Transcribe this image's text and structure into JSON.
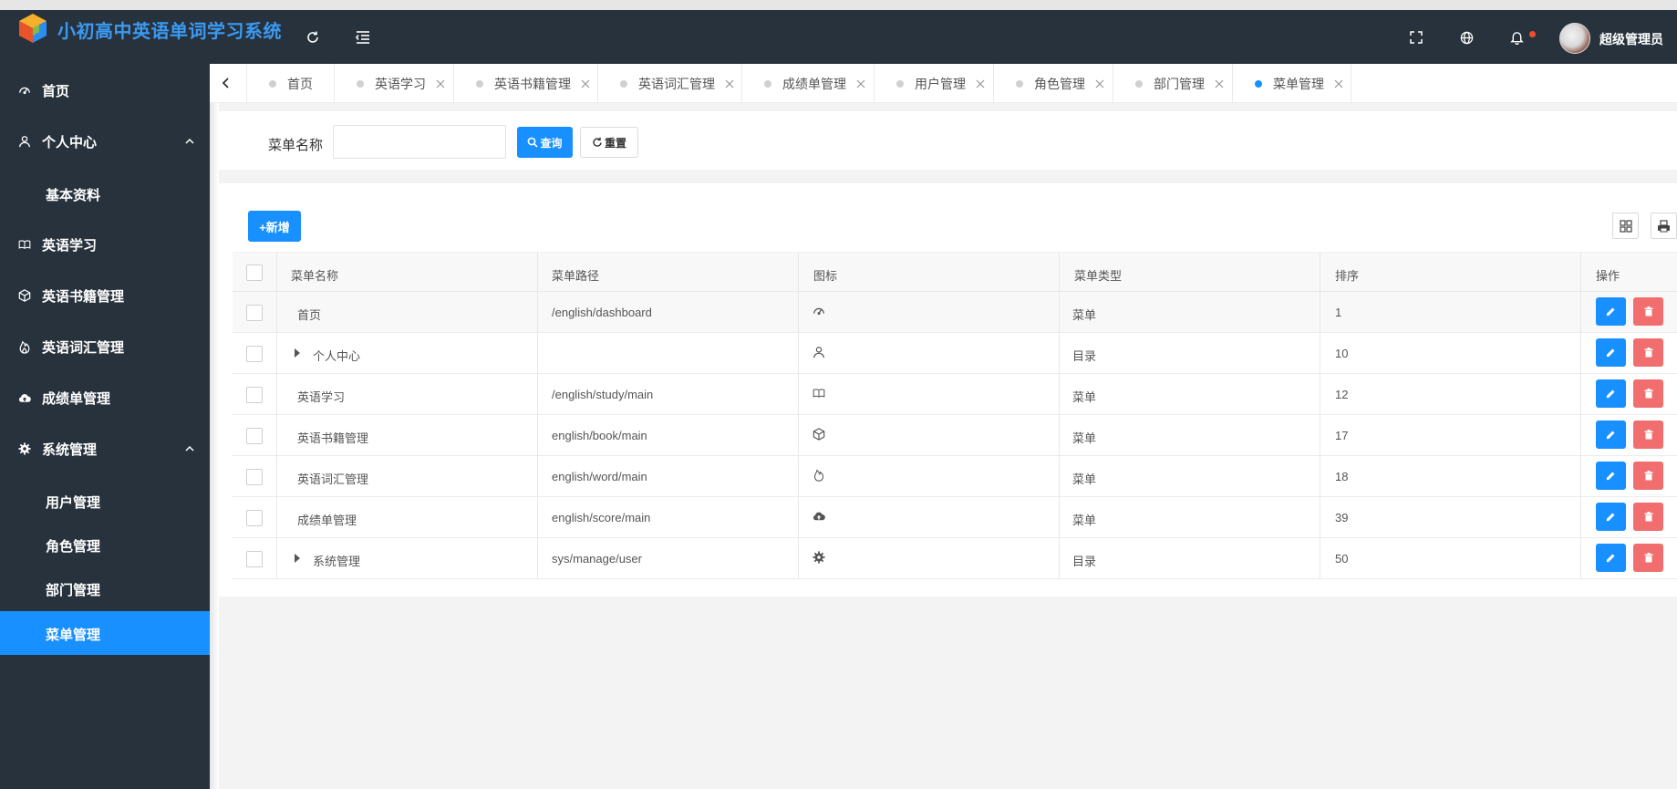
{
  "app": {
    "title": "小初高中英语单词学习系统",
    "user_name": "超级管理员"
  },
  "header_icons": [
    "refresh-icon",
    "menu-fold-icon",
    "fullscreen-icon",
    "globe-icon",
    "bell-icon"
  ],
  "sidebar": {
    "items": [
      {
        "label": "首页",
        "icon": "dashboard-icon"
      },
      {
        "label": "个人中心",
        "icon": "user-icon",
        "expanded": true,
        "children": [
          {
            "label": "基本资料"
          }
        ]
      },
      {
        "label": "英语学习",
        "icon": "book-open-icon"
      },
      {
        "label": "英语书籍管理",
        "icon": "cube-icon"
      },
      {
        "label": "英语词汇管理",
        "icon": "fire-icon"
      },
      {
        "label": "成绩单管理",
        "icon": "cloud-upload-icon"
      },
      {
        "label": "系统管理",
        "icon": "settings-icon",
        "expanded": true,
        "children": [
          {
            "label": "用户管理"
          },
          {
            "label": "角色管理"
          },
          {
            "label": "部门管理"
          },
          {
            "label": "菜单管理",
            "active": true
          }
        ]
      }
    ]
  },
  "tabs": [
    {
      "label": "首页",
      "closable": false,
      "active": false
    },
    {
      "label": "英语学习",
      "closable": true,
      "active": false
    },
    {
      "label": "英语书籍管理",
      "closable": true,
      "active": false
    },
    {
      "label": "英语词汇管理",
      "closable": true,
      "active": false
    },
    {
      "label": "成绩单管理",
      "closable": true,
      "active": false
    },
    {
      "label": "用户管理",
      "closable": true,
      "active": false
    },
    {
      "label": "角色管理",
      "closable": true,
      "active": false
    },
    {
      "label": "部门管理",
      "closable": true,
      "active": false
    },
    {
      "label": "菜单管理",
      "closable": true,
      "active": true
    }
  ],
  "search": {
    "label": "菜单名称",
    "value": "",
    "placeholder": "",
    "query_label": "查询",
    "reset_label": "重置"
  },
  "toolbar": {
    "add_label": "+新增"
  },
  "table": {
    "columns": [
      "菜单名称",
      "菜单路径",
      "图标",
      "菜单类型",
      "排序",
      "操作"
    ],
    "rows": [
      {
        "name": "首页",
        "path": "/english/dashboard",
        "icon": "dashboard-icon",
        "type": "菜单",
        "order": "1",
        "expandable": false
      },
      {
        "name": "个人中心",
        "path": "",
        "icon": "user-icon",
        "type": "目录",
        "order": "10",
        "expandable": true
      },
      {
        "name": "英语学习",
        "path": "/english/study/main",
        "icon": "book-open-icon",
        "type": "菜单",
        "order": "12",
        "expandable": false
      },
      {
        "name": "英语书籍管理",
        "path": "english/book/main",
        "icon": "cube-icon",
        "type": "菜单",
        "order": "17",
        "expandable": false
      },
      {
        "name": "英语词汇管理",
        "path": "english/word/main",
        "icon": "fire-icon",
        "type": "菜单",
        "order": "18",
        "expandable": false
      },
      {
        "name": "成绩单管理",
        "path": "english/score/main",
        "icon": "cloud-upload-icon",
        "type": "菜单",
        "order": "39",
        "expandable": false
      },
      {
        "name": "系统管理",
        "path": "sys/manage/user",
        "icon": "settings-icon",
        "type": "目录",
        "order": "50",
        "expandable": true
      }
    ]
  },
  "colors": {
    "sidebar_bg": "#28323d",
    "accent": "#1890ff",
    "title": "#3a9af3",
    "danger": "#f26d6d",
    "notification_dot": "#f04c2c"
  }
}
